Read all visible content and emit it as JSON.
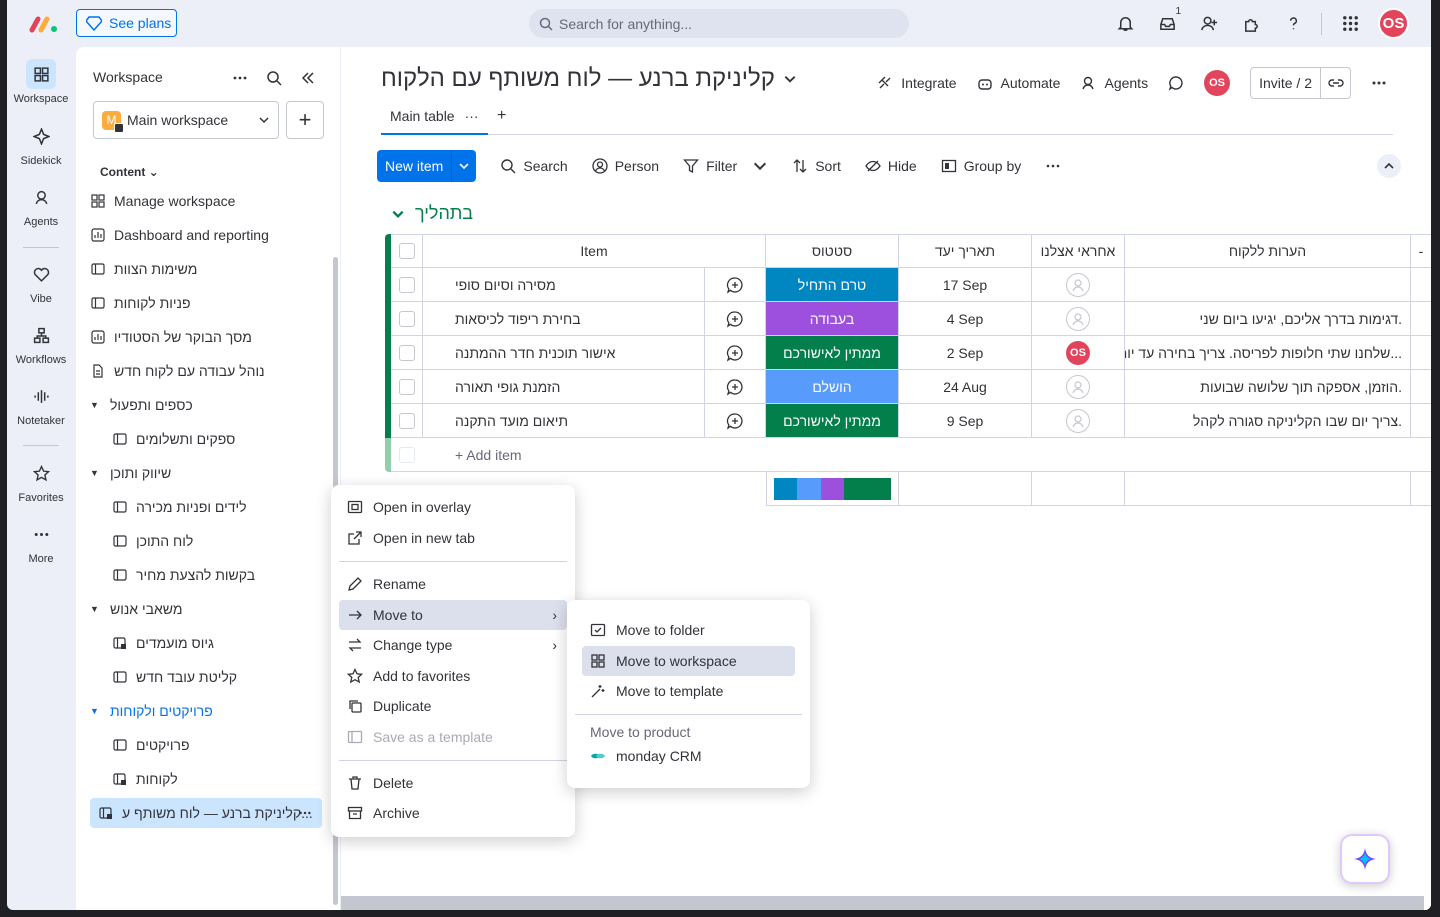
{
  "topbar": {
    "see_plans": "See plans",
    "search_placeholder": "Search for anything...",
    "inbox_badge": "1",
    "avatar": "OS"
  },
  "rail": [
    {
      "label": "Workspace"
    },
    {
      "label": "Sidekick"
    },
    {
      "label": "Agents"
    },
    {
      "label": "Vibe"
    },
    {
      "label": "Workflows"
    },
    {
      "label": "Notetaker"
    },
    {
      "label": "Favorites"
    },
    {
      "label": "More"
    }
  ],
  "sidebar": {
    "header": "Workspace",
    "workspace_letter": "M",
    "workspace_name": "Main workspace",
    "content_label": "Content",
    "items": [
      {
        "label": "Manage workspace"
      },
      {
        "label": "Dashboard and reporting"
      },
      {
        "label": "משימות הצוות"
      },
      {
        "label": "פניות לקוחות"
      },
      {
        "label": "מסך הבוקר של הסטודיו"
      },
      {
        "label": "נוהל עבודה עם לקוח חדש"
      },
      {
        "label": "כספים ותפעול"
      },
      {
        "label": "ספקים ותשלומים"
      },
      {
        "label": "שיווק ותוכן"
      },
      {
        "label": "לידים ופניות מכירה"
      },
      {
        "label": "לוח התוכן"
      },
      {
        "label": "בקשות להצעת מחיר"
      },
      {
        "label": "משאבי אנוש"
      },
      {
        "label": "גיוס מועמדים"
      },
      {
        "label": "קליטת עובד חדש"
      },
      {
        "label": "פרויקטים ולקוחות"
      },
      {
        "label": "פרויקטים"
      },
      {
        "label": "לקוחות"
      },
      {
        "label": "קליניקת ברנע — לוח משותף ע..."
      }
    ]
  },
  "board": {
    "title": "קליניקת ברנע — לוח משותף עם הלקוח",
    "actions": {
      "integrate": "Integrate",
      "automate": "Automate",
      "agents": "Agents",
      "avatar": "OS",
      "invite": "Invite / 2"
    },
    "tab": "Main table",
    "toolbar": {
      "new_item": "New item",
      "search": "Search",
      "person": "Person",
      "filter": "Filter",
      "sort": "Sort",
      "hide": "Hide",
      "group_by": "Group by"
    },
    "group_title": "בתהליך",
    "columns": {
      "item": "Item",
      "status": "סטטוס",
      "date": "תאריך יעד",
      "owner": "אחראי אצלנו",
      "notes": "הערות ללקוח"
    },
    "rows": [
      {
        "item": "מסירה וסיום סופי",
        "status": "טרם התחיל",
        "status_color": "#0086c0",
        "date": "17 Sep",
        "owner": "",
        "notes": ""
      },
      {
        "item": "בחירת ריפוד לכיסאות",
        "status": "בעבודה",
        "status_color": "#9d50dd",
        "date": "4 Sep",
        "owner": "",
        "notes": "דגימות בדרך אליכם, יגיעו ביום שני."
      },
      {
        "item": "אישור תוכנית חדר ההמתנה",
        "status": "ממתין לאישורכם",
        "status_color": "#037f4c",
        "date": "2 Sep",
        "owner": "OS",
        "notes": "שלחנו שתי חלופות לפריסה. צריך בחירה עד יום..."
      },
      {
        "item": "הזמנת גופי תאורה",
        "status": "הושלם",
        "status_color": "#579bfc",
        "date": "24 Aug",
        "owner": "",
        "notes": "הוזמן, אספקה תוך שלושה שבועות."
      },
      {
        "item": "תיאום מועד התקנה",
        "status": "ממתין לאישורכם",
        "status_color": "#037f4c",
        "date": "9 Sep",
        "owner": "",
        "notes": "צריך יום שבו הקליניקה סגורה לקהל."
      }
    ],
    "add_item": "+ Add item",
    "summary_colors": [
      "#0086c0",
      "#579bfc",
      "#9d50dd",
      "#037f4c",
      "#037f4c"
    ]
  },
  "context_menu": {
    "items": [
      "Open in overlay",
      "Open in new tab",
      "Rename",
      "Move to",
      "Change type",
      "Add to favorites",
      "Duplicate",
      "Save as a template",
      "Delete",
      "Archive"
    ]
  },
  "submenu": {
    "items": [
      "Move to folder",
      "Move to workspace",
      "Move to template"
    ],
    "product_label": "Move to product",
    "product": "monday CRM"
  }
}
